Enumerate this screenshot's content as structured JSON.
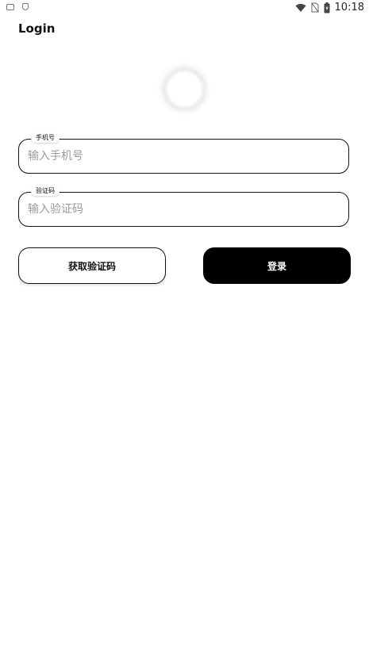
{
  "status_bar": {
    "time": "10:18",
    "left_icons": [
      "notification-icon",
      "shield-icon"
    ],
    "right_icons": [
      "wifi-icon",
      "no-sim-icon",
      "battery-charging-icon"
    ]
  },
  "app_bar": {
    "title": "Login"
  },
  "avatar": {
    "icon": "avatar-icon"
  },
  "phone_field": {
    "label": "手机号",
    "placeholder": "输入手机号",
    "value": ""
  },
  "code_field": {
    "label": "验证码",
    "placeholder": "输入验证码",
    "value": ""
  },
  "buttons": {
    "get_code": "获取验证码",
    "login": "登录"
  },
  "colors": {
    "primary": "#000000",
    "background": "#ffffff",
    "placeholder": "#9a9a9a"
  }
}
